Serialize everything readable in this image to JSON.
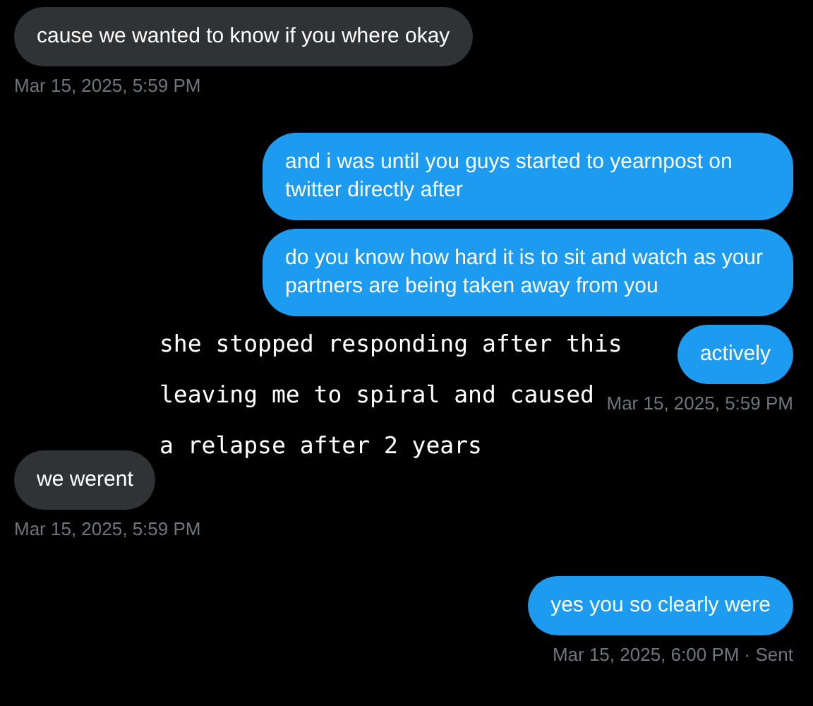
{
  "groups": [
    {
      "kind": "received",
      "messages": [
        "cause we wanted to know if you where okay"
      ],
      "timestamp": "Mar 15, 2025, 5:59 PM"
    },
    {
      "kind": "sent",
      "messages": [
        "and i was until you guys started to yearnpost on twitter directly after",
        "do you know how hard it is to sit and watch as your partners are being taken away from you",
        "actively"
      ],
      "timestamp": "Mar 15, 2025, 5:59 PM"
    },
    {
      "kind": "received",
      "messages": [
        "we werent"
      ],
      "timestamp": "Mar 15, 2025, 5:59 PM"
    },
    {
      "kind": "sent",
      "messages": [
        "yes you so clearly were"
      ],
      "timestamp": "Mar 15, 2025, 6:00 PM · Sent"
    }
  ],
  "caption": [
    "she stopped responding after this",
    "leaving me to spiral and caused",
    "a relapse after 2 years"
  ]
}
